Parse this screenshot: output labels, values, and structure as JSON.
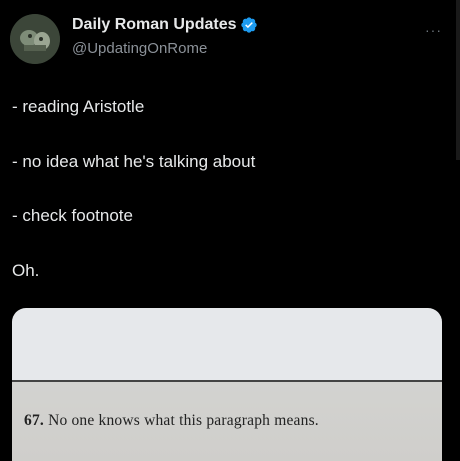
{
  "author": {
    "display_name": "Daily Roman Updates",
    "handle": "@UpdatingOnRome",
    "verified": true,
    "verified_icon": "verified-badge-icon",
    "avatar_icon": "avatar-image"
  },
  "menu": {
    "more_label": "···",
    "more_icon": "more-options-icon"
  },
  "tweet": {
    "lines": [
      "- reading Aristotle",
      "- no idea what he's talking about",
      "- check footnote",
      "Oh."
    ]
  },
  "media": {
    "footnote_number": "67.",
    "footnote_text": "No one knows what this paragraph means."
  },
  "colors": {
    "background": "#000000",
    "text": "#e7e9ea",
    "secondary_text": "#8b9198",
    "verified_blue": "#1d9bf0"
  }
}
